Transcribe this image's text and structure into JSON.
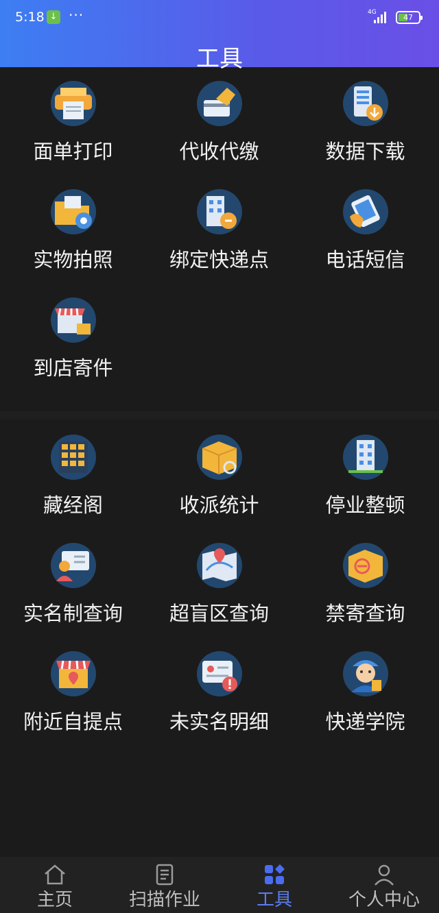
{
  "status_bar": {
    "time": "5:18",
    "download_glyph": "↓",
    "dots": "···",
    "network": "4G",
    "battery": "47"
  },
  "header": {
    "title": "工具"
  },
  "tools_section_1": [
    {
      "label": "面单打印",
      "icon": "printer-icon"
    },
    {
      "label": "代收代缴",
      "icon": "card-payment-icon"
    },
    {
      "label": "数据下载",
      "icon": "data-download-icon"
    },
    {
      "label": "实物拍照",
      "icon": "photo-folder-icon"
    },
    {
      "label": "绑定快递点",
      "icon": "bind-building-icon"
    },
    {
      "label": "电话短信",
      "icon": "phone-message-icon"
    },
    {
      "label": "到店寄件",
      "icon": "store-send-icon"
    }
  ],
  "tools_section_2": [
    {
      "label": "藏经阁",
      "icon": "library-shelf-icon"
    },
    {
      "label": "收派统计",
      "icon": "parcel-stats-icon"
    },
    {
      "label": "停业整顿",
      "icon": "closed-building-icon"
    },
    {
      "label": "实名制查询",
      "icon": "id-card-search-icon"
    },
    {
      "label": "超盲区查询",
      "icon": "map-pin-icon"
    },
    {
      "label": "禁寄查询",
      "icon": "forbidden-box-icon"
    },
    {
      "label": "附近自提点",
      "icon": "nearby-store-icon"
    },
    {
      "label": "未实名明细",
      "icon": "id-alert-icon"
    },
    {
      "label": "快递学院",
      "icon": "courier-academy-icon"
    }
  ],
  "tabbar": [
    {
      "label": "主页",
      "icon": "home-icon",
      "active": false
    },
    {
      "label": "扫描作业",
      "icon": "scan-task-icon",
      "active": false
    },
    {
      "label": "工具",
      "icon": "tools-grid-icon",
      "active": true
    },
    {
      "label": "个人中心",
      "icon": "person-icon",
      "active": false
    }
  ],
  "colors": {
    "accent": "#5b7cf0",
    "header_start": "#3d7ef3",
    "header_end": "#6a4fe6",
    "background": "#1b1b1b"
  }
}
